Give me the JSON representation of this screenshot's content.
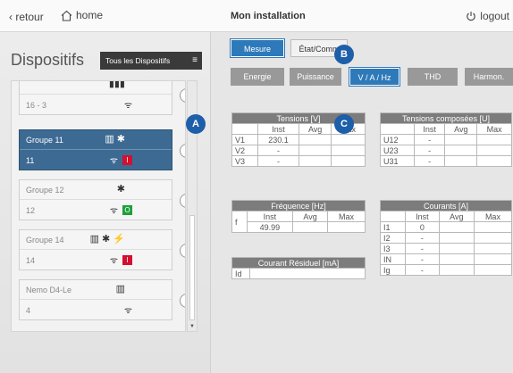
{
  "header": {
    "back_label": "retour",
    "home_label": "home",
    "title": "Mon installation",
    "logout_label": "logout"
  },
  "sidebar": {
    "title": "Dispositifs",
    "filter_label": "Tous les Dispositifs",
    "devices": [
      {
        "name": "",
        "id": "16 - 3",
        "icons": "▮▮▮",
        "status": "",
        "selected": false
      },
      {
        "name": "Groupe 11",
        "id": "11",
        "icons": "▥ ✱",
        "status": "I",
        "selected": true
      },
      {
        "name": "Groupe 12",
        "id": "12",
        "icons": "✱",
        "status": "O",
        "selected": false
      },
      {
        "name": "Groupe 14",
        "id": "14",
        "icons": "▥ ✱ ⚡",
        "status": "I",
        "selected": false
      },
      {
        "name": "Nemo D4-Le",
        "id": "4",
        "icons": "▥",
        "status": "",
        "selected": false
      }
    ]
  },
  "tabs": {
    "mesure": "Mesure",
    "etat": "État/Comm",
    "energie": "Energie",
    "puissance": "Puissance",
    "vah": "V / A / Hz",
    "thd": "THD",
    "harmon": "Harmon."
  },
  "tensions": {
    "title": "Tensions [V]",
    "cols": [
      "Inst",
      "Avg",
      "Max"
    ],
    "rows": [
      {
        "label": "V1",
        "inst": "230.1",
        "avg": "",
        "max": ""
      },
      {
        "label": "V2",
        "inst": "-",
        "avg": "",
        "max": ""
      },
      {
        "label": "V3",
        "inst": "-",
        "avg": "",
        "max": ""
      }
    ]
  },
  "tensions_composees": {
    "title": "Tensions composées [U]",
    "cols": [
      "Inst",
      "Avg",
      "Max"
    ],
    "rows": [
      {
        "label": "U12",
        "inst": "-",
        "avg": "",
        "max": ""
      },
      {
        "label": "U23",
        "inst": "-",
        "avg": "",
        "max": ""
      },
      {
        "label": "U31",
        "inst": "-",
        "avg": "",
        "max": ""
      }
    ]
  },
  "frequence": {
    "title": "Fréquence [Hz]",
    "cols": [
      "Inst",
      "Avg",
      "Max"
    ],
    "row": {
      "label": "f",
      "inst": "49.99",
      "avg": "",
      "max": ""
    }
  },
  "courants": {
    "title": "Courants [A]",
    "cols": [
      "Inst",
      "Avg",
      "Max"
    ],
    "rows": [
      {
        "label": "I1",
        "inst": "0"
      },
      {
        "label": "I2",
        "inst": "-"
      },
      {
        "label": "I3",
        "inst": "-"
      },
      {
        "label": "IN",
        "inst": "-"
      },
      {
        "label": "Ig",
        "inst": "-"
      }
    ]
  },
  "residuel": {
    "title": "Courant Résiduel [mA]",
    "label": "Id"
  },
  "callouts": {
    "a": "A",
    "b": "B",
    "c": "C"
  }
}
